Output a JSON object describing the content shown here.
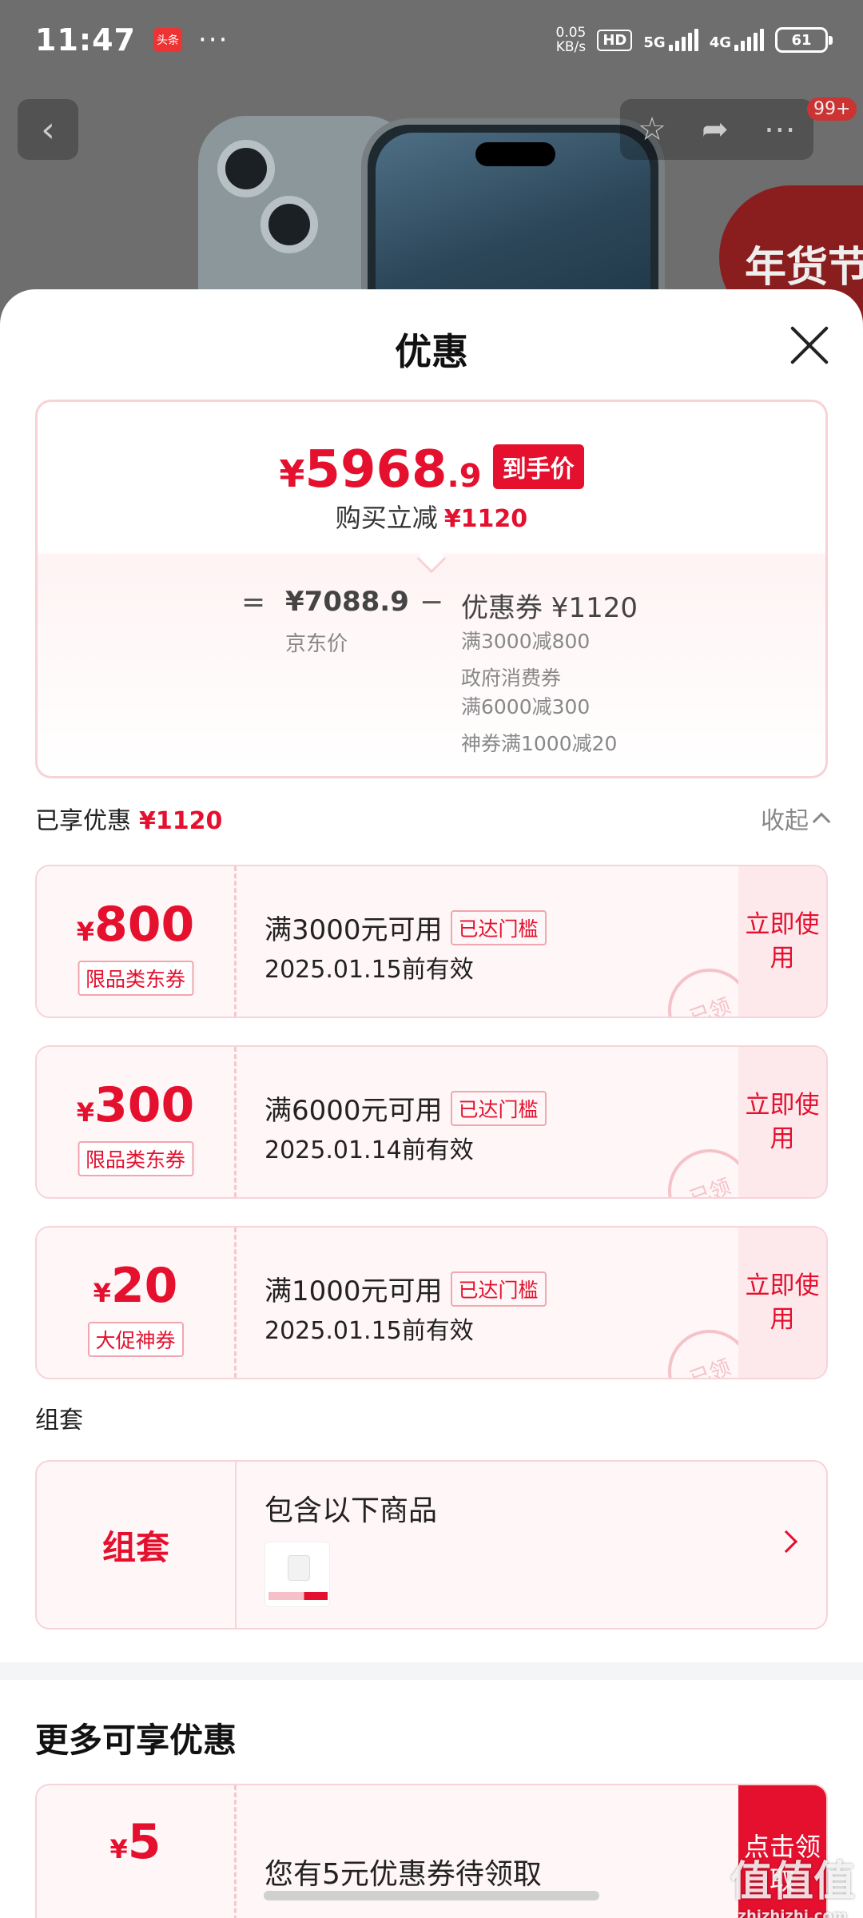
{
  "status_bar": {
    "time": "11:47",
    "app_icon": "头条",
    "speed_value": "0.05",
    "speed_unit": "KB/s",
    "hd": "HD",
    "net1": "5G",
    "net2": "4G",
    "battery": "61"
  },
  "background": {
    "badge": "99+",
    "festival": "年货节"
  },
  "sheet": {
    "title": "优惠",
    "final_price": {
      "yen": "¥",
      "integer": "5968",
      "decimal": ".9",
      "tag": "到手价"
    },
    "instant_cut": {
      "label": "购买立减",
      "amount": "¥1120"
    },
    "calc": {
      "equals": "=",
      "jd_price": "¥7088.9",
      "jd_label": "京东价",
      "minus": "−",
      "coupon_total": "优惠券 ¥1120",
      "details": [
        "满3000减800",
        "政府消费券",
        "满6000减300",
        "神券满1000减20"
      ]
    },
    "enjoyed": {
      "label": "已享优惠",
      "amount": "¥1120",
      "collapse": "收起"
    },
    "coupons": [
      {
        "yen": "¥",
        "value": "800",
        "tag": "限品类东券",
        "condition": "满3000元可用",
        "reached": "已达门槛",
        "valid": "2025.01.15前有效",
        "action": "立即使用",
        "stamp": "已领"
      },
      {
        "yen": "¥",
        "value": "300",
        "tag": "限品类东券",
        "condition": "满6000元可用",
        "reached": "已达门槛",
        "valid": "2025.01.14前有效",
        "action": "立即使用",
        "stamp": "已领"
      },
      {
        "yen": "¥",
        "value": "20",
        "tag": "大促神券",
        "condition": "满1000元可用",
        "reached": "已达门槛",
        "valid": "2025.01.15前有效",
        "action": "立即使用",
        "stamp": "已领"
      }
    ],
    "bundle": {
      "section_label": "组套",
      "left_label": "组套",
      "title": "包含以下商品"
    },
    "more": {
      "title": "更多可享优惠",
      "coupon": {
        "yen": "¥",
        "value": "5",
        "text": "您有5元优惠券待领取",
        "action": "点击领取"
      }
    }
  },
  "watermark": {
    "line1": "值值值",
    "line2": "zhizhizhi.com"
  }
}
